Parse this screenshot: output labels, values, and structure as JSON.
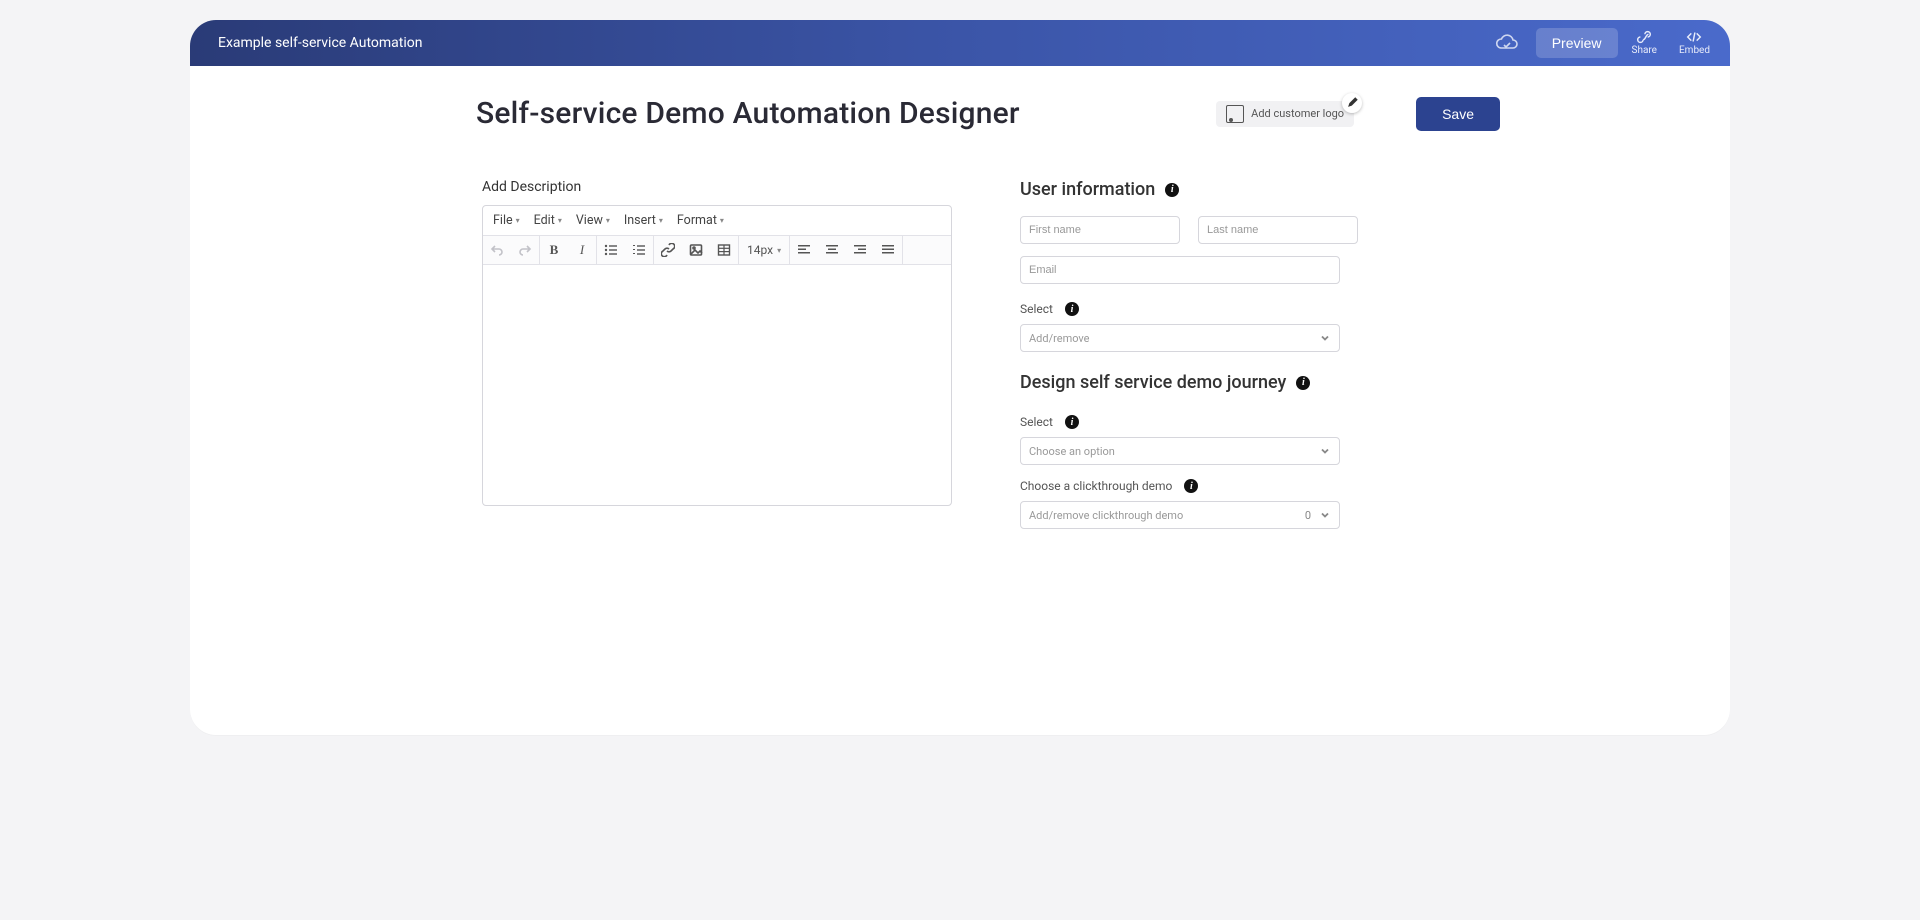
{
  "topbar": {
    "title": "Example self-service Automation",
    "preview_label": "Preview",
    "share_label": "Share",
    "embed_label": "Embed"
  },
  "header": {
    "page_title": "Self-service Demo Automation Designer",
    "logo_pill_text": "Add customer logo",
    "save_label": "Save"
  },
  "left": {
    "description_label": "Add Description",
    "editor_menu": {
      "file": "File",
      "edit": "Edit",
      "view": "View",
      "insert": "Insert",
      "format": "Format"
    },
    "font_size": "14px"
  },
  "right": {
    "user_info_heading": "User information",
    "first_name_ph": "First name",
    "last_name_ph": "Last name",
    "email_ph": "Email",
    "select_label": "Select",
    "addremove_ph": "Add/remove",
    "journey_heading": "Design self service demo journey",
    "select2_label": "Select",
    "choose_option_ph": "Choose an option",
    "clickthrough_label": "Choose a clickthrough demo",
    "clickthrough_ph": "Add/remove clickthrough demo",
    "clickthrough_count": "0"
  }
}
